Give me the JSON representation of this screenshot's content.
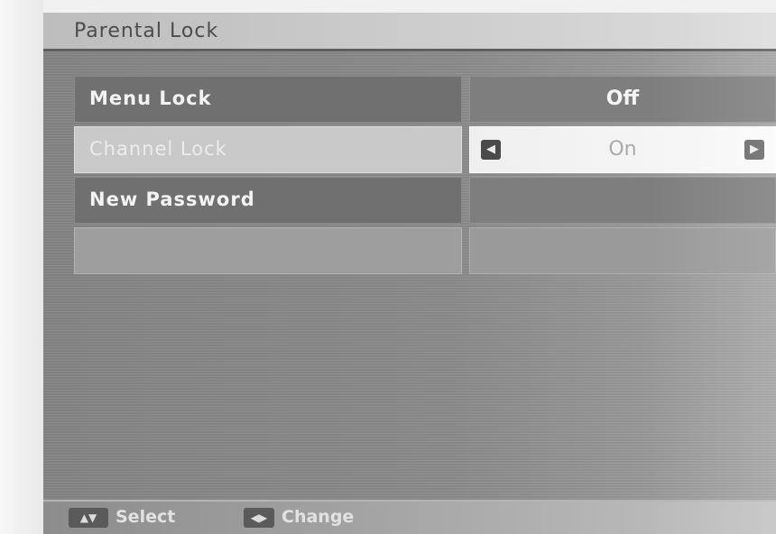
{
  "title": "Parental Lock",
  "menu": {
    "items": [
      {
        "label": "Menu Lock",
        "value": "Off"
      },
      {
        "label": "Channel Lock",
        "value": "On"
      },
      {
        "label": "New Password",
        "value": ""
      },
      {
        "label": "",
        "value": ""
      }
    ]
  },
  "footer": {
    "select_label": "Select",
    "change_label": "Change"
  },
  "icons": {
    "left": "arrow-left-icon",
    "right": "arrow-right-icon",
    "nav": "nav-keys-icon",
    "change": "left-right-keys-icon"
  },
  "colors": {
    "screen_bg": "#888888",
    "selected_value_bg": "#f4f4f4",
    "title_bar": "#c8c8c8"
  }
}
